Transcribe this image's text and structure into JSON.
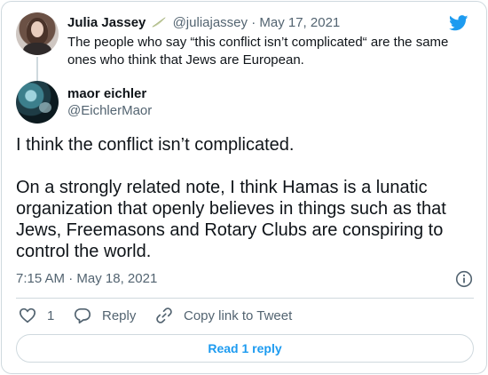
{
  "parent_tweet": {
    "author_name": "Julia Jassey",
    "author_handle": "@juliajassey",
    "separator": "·",
    "date": "May 17, 2021",
    "text": "The people who say “this conflict isn’t complicated“ are the same ones who think that Jews are European."
  },
  "tweet": {
    "author_name": "maor eichler",
    "author_handle": "@EichlerMaor",
    "paragraph_1": "I think the conflict isn’t complicated.",
    "paragraph_2": "On a strongly related note, I think Hamas is a lunatic organization that openly believes in things such as that Jews, Freemasons and Rotary Clubs are conspiring to control the world.",
    "time": "7:15 AM",
    "separator": "·",
    "date": "May 18, 2021"
  },
  "actions": {
    "like_count": "1",
    "reply_label": "Reply",
    "copy_link_label": "Copy link to Tweet"
  },
  "read_replies_label": "Read 1 reply",
  "colors": {
    "accent": "#1d9bf0",
    "secondary_text": "#536471",
    "border": "#cfd9de"
  },
  "icons": [
    "twitter-bird-icon",
    "leaf-icon",
    "info-icon",
    "heart-icon",
    "reply-icon",
    "link-icon"
  ]
}
